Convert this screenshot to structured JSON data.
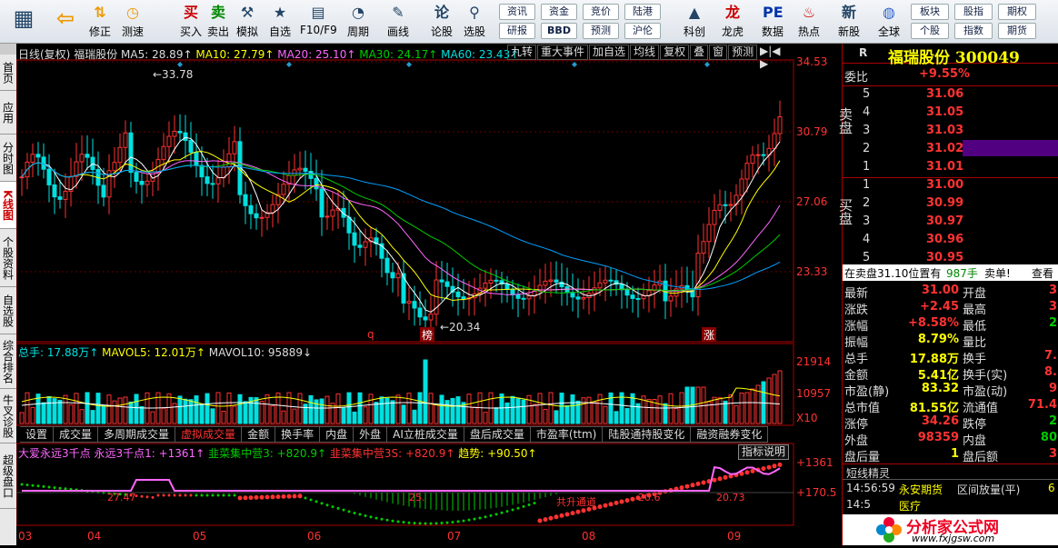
{
  "toolbar": {
    "buttons": [
      {
        "label": "",
        "icon": "grid-icon"
      },
      {
        "label": "",
        "icon": "back-arrow-icon"
      },
      {
        "label": "修正",
        "icon": "up-down-icon"
      },
      {
        "label": "测速",
        "icon": "clock-icon"
      },
      {
        "label": "买入",
        "icon": "buy-icon"
      },
      {
        "label": "卖出",
        "icon": "sell-icon"
      },
      {
        "label": "模拟",
        "icon": "hammer-icon"
      },
      {
        "label": "自选",
        "icon": "watchlist-icon"
      },
      {
        "label": "F10/F9",
        "icon": "f10-icon"
      },
      {
        "label": "周期",
        "icon": "period-icon"
      },
      {
        "label": "画线",
        "icon": "pencil-icon"
      },
      {
        "label": "论股",
        "icon": "discuss-icon"
      },
      {
        "label": "选股",
        "icon": "select-stock-icon"
      },
      {
        "label": "科创",
        "icon": "tech-icon"
      },
      {
        "label": "龙虎",
        "icon": "dragon-tiger-icon"
      },
      {
        "label": "数据",
        "icon": "pe-icon"
      },
      {
        "label": "热点",
        "icon": "hot-icon"
      },
      {
        "label": "新股",
        "icon": "ipo-icon"
      },
      {
        "label": "全球",
        "icon": "globe-icon"
      }
    ],
    "grid1": [
      "资讯",
      "资金",
      "竞价",
      "陆港",
      "研报",
      "BBD",
      "预测",
      "沪伦"
    ],
    "grid2": [
      "板块",
      "股指",
      "期权",
      "个股",
      "指数",
      "期货"
    ]
  },
  "left_tabs": [
    "首页",
    "应用",
    "分时图",
    "K线图",
    "个股资料",
    "自选股",
    "综合排名",
    "牛叉诊股",
    "超级盘口"
  ],
  "chart": {
    "header": {
      "period": "日线(复权)",
      "name": "福瑞股份",
      "ma5": "MA5: 28.89↑",
      "ma10": "MA10: 27.79↑",
      "ma20": "MA20: 25.10↑",
      "ma30": "MA30: 24.17↑",
      "ma60": "MA60: 23.43↑"
    },
    "right_tabs": [
      "九转",
      "重大事件",
      "加自选",
      "均线",
      "复权",
      "叠",
      "窗",
      "预测"
    ],
    "price_axis": [
      "34.53",
      "30.79",
      "27.06",
      "23.33"
    ],
    "high_label": "33.78",
    "low_label": "20.34",
    "markers": [
      "榜",
      "涨"
    ],
    "q_marker": "q",
    "vol_header": {
      "total": "总手: 17.88万↑",
      "mavol5": "MAVOL5: 12.01万↑",
      "mavol10": "MAVOL10: 95889↓"
    },
    "vol_axis": [
      "21914",
      "10957",
      "X10"
    ],
    "bottom_tabs": [
      "设置",
      "成交量",
      "多周期成交量",
      "虚拟成交量",
      "金额",
      "换手率",
      "内盘",
      "外盘",
      "AI立桩成交量",
      "盘后成交量",
      "市盈率(ttm)",
      "陆股通持股变化",
      "融资融券变化"
    ],
    "active_bottom_tab": "虚拟成交量",
    "ind_header": {
      "a": "大爱永远3千点 永远3千点1: +1361↑",
      "b": "韭菜集中营3: +820.9↑",
      "c": "韭菜集中营3S: +820.9↑",
      "d": "趋势: +90.50↑"
    },
    "ind_button": "指标说明",
    "ind_axis": [
      "+1361",
      "+170.5"
    ],
    "ind_labels": [
      "27.47",
      "25.",
      "共升通道",
      "20.6",
      "20.73"
    ],
    "months": [
      "03",
      "04",
      "05",
      "06",
      "07",
      "08",
      "09"
    ]
  },
  "right_panel": {
    "mode": "R",
    "title": "福瑞股份 300049",
    "wei_bi": {
      "label": "委比",
      "value": "+9.55%"
    },
    "sell_label": "卖盘",
    "buy_label": "买盘",
    "asks": [
      {
        "n": "5",
        "p": "31.06"
      },
      {
        "n": "4",
        "p": "31.05"
      },
      {
        "n": "3",
        "p": "31.03"
      },
      {
        "n": "2",
        "p": "31.02"
      },
      {
        "n": "1",
        "p": "31.01"
      }
    ],
    "bids": [
      {
        "n": "1",
        "p": "31.00"
      },
      {
        "n": "2",
        "p": "30.99"
      },
      {
        "n": "3",
        "p": "30.97"
      },
      {
        "n": "4",
        "p": "30.96"
      },
      {
        "n": "5",
        "p": "30.95"
      }
    ],
    "info_bar": {
      "a": "在卖盘31.10位置有",
      "b": "987手",
      "c": "卖单!",
      "d": "查看"
    },
    "stats": [
      [
        "最新",
        "31.00",
        "开盘",
        "3"
      ],
      [
        "涨跌",
        "+2.45",
        "最高",
        "3"
      ],
      [
        "涨幅",
        "+8.58%",
        "最低",
        "2"
      ],
      [
        "振幅",
        "8.79%",
        "量比",
        ""
      ],
      [
        "总手",
        "17.88万",
        "换手",
        "7."
      ],
      [
        "金额",
        "5.41亿",
        "换手(实)",
        "8."
      ],
      [
        "市盈(静)",
        "83.32",
        "市盈(动)",
        "9"
      ],
      [
        "总市值",
        "81.55亿",
        "流通值",
        "71.4"
      ],
      [
        "涨停",
        "34.26",
        "跌停",
        "2"
      ],
      [
        "外盘",
        "98359",
        "内盘",
        "80"
      ],
      [
        "盘后量",
        "1",
        "盘后额",
        "3"
      ]
    ],
    "news_title": "短线精灵",
    "news_row": {
      "time": "14:56:59",
      "name": "永安期货",
      "event": "区间放量(平)",
      "extra": "6"
    },
    "news_row2": {
      "time": "14:5",
      "name": "医疗"
    },
    "watermark": "分析家公式网",
    "watermark_url": "www.fxjgsw.com"
  }
}
